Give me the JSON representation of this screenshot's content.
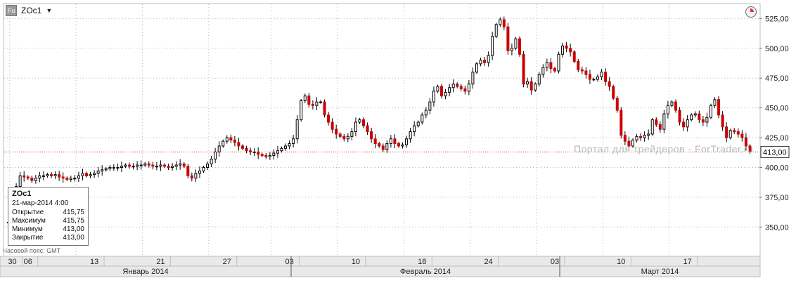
{
  "header": {
    "symbol": "ZOc1",
    "dropdown_glyph": "▼",
    "icon_label": "Fu"
  },
  "watermark": "Портал для трейдеров - ForTrader.ru",
  "timezone_label": "Часовой пояс: GMT",
  "info_box": {
    "title": "ZOc1",
    "date": "21-мар-2014 4:00",
    "rows": [
      {
        "label": "Открытие",
        "value": "415,75"
      },
      {
        "label": "Максимум",
        "value": "415,75"
      },
      {
        "label": "Минимум",
        "value": "413,00"
      },
      {
        "label": "Закрытие",
        "value": "413,00"
      }
    ]
  },
  "colors": {
    "up": "#ffffff",
    "down": "#cc0000",
    "wick": "#000000",
    "last_price_line": "#cc3333",
    "grid": "#bbbbbb"
  },
  "chart_data": {
    "type": "candlestick",
    "ylim": [
      326,
      537
    ],
    "y_ticks": [
      "350,00",
      "375,00",
      "400,00",
      "425,00",
      "450,00",
      "475,00",
      "500,00",
      "525,00"
    ],
    "y_tick_values": [
      350,
      375,
      400,
      425,
      450,
      475,
      500,
      525
    ],
    "last_price": "413,00",
    "last_price_value": 413,
    "x_tick_labels": [
      "30",
      "06",
      "13",
      "21",
      "27",
      "03",
      "10",
      "18",
      "24",
      "03",
      "10",
      "17"
    ],
    "month_labels": [
      "Январь 2014",
      "Февраль 2014",
      "Март 2014"
    ],
    "series": [
      {
        "name": "ZOc1",
        "closes": [
          354,
          356,
          384,
          393,
          392,
          391,
          389,
          391,
          393,
          393,
          394,
          393,
          394,
          392,
          391,
          390,
          391,
          391,
          393,
          395,
          393,
          394,
          395,
          397,
          398,
          399,
          400,
          400,
          400,
          401,
          402,
          401,
          401,
          402,
          402,
          403,
          402,
          401,
          401,
          402,
          401,
          400,
          401,
          402,
          403,
          401,
          393,
          391,
          395,
          397,
          400,
          403,
          407,
          413,
          418,
          422,
          425,
          423,
          421,
          418,
          416,
          414,
          413,
          413,
          411,
          410,
          409,
          410,
          412,
          414,
          416,
          418,
          420,
          424,
          440,
          456,
          460,
          453,
          452,
          455,
          455,
          444,
          438,
          432,
          428,
          426,
          424,
          426,
          430,
          438,
          440,
          435,
          430,
          424,
          420,
          418,
          415,
          420,
          424,
          420,
          418,
          419,
          424,
          430,
          435,
          438,
          444,
          448,
          455,
          464,
          468,
          460,
          463,
          467,
          470,
          468,
          466,
          464,
          470,
          480,
          487,
          490,
          488,
          494,
          510,
          520,
          524,
          518,
          498,
          500,
          508,
          495,
          470,
          472,
          465,
          470,
          478,
          484,
          488,
          483,
          481,
          495,
          502,
          500,
          497,
          489,
          482,
          481,
          478,
          474,
          474,
          476,
          480,
          472,
          468,
          458,
          448,
          427,
          422,
          418,
          423,
          426,
          425,
          427,
          428,
          440,
          436,
          432,
          445,
          452,
          455,
          448,
          438,
          434,
          440,
          444,
          445,
          440,
          438,
          442,
          452,
          457,
          444,
          434,
          425,
          431,
          430,
          428,
          425,
          418,
          413
        ]
      }
    ]
  }
}
